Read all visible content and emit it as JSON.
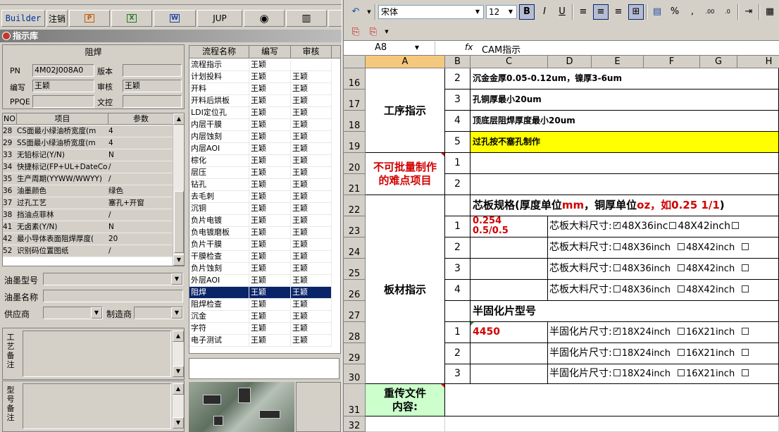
{
  "toolbar": {
    "builder_label": "Builder",
    "logout_label": "注销",
    "jup_label": "JUP"
  },
  "library": {
    "title": "指示库"
  },
  "info": {
    "title": "阻焊",
    "pn_label": "PN",
    "pn_value": "4M02J008A0",
    "version_label": "版本",
    "version_value": "",
    "author_label": "编写",
    "author_value": "王颖",
    "reviewer_label": "审核",
    "reviewer_value": "王颖",
    "ppqe_label": "PPQE",
    "ppqe_value": "",
    "doc_label": "文控",
    "doc_value": ""
  },
  "params": {
    "headers": [
      "NO",
      "项目",
      "参数"
    ],
    "rows": [
      {
        "no": "28",
        "item": "CS面最小绿油桥宽度(m",
        "value": "4"
      },
      {
        "no": "29",
        "item": "SS面最小绿油桥宽度(m",
        "value": "4"
      },
      {
        "no": "33",
        "item": "无铅标记(Y/N)",
        "value": "N"
      },
      {
        "no": "34",
        "item": "快捷标记(FP+UL+DateCo",
        "value": "/"
      },
      {
        "no": "35",
        "item": "生产周期(YYWW/WWYY)",
        "value": "/"
      },
      {
        "no": "36",
        "item": "油墨颜色",
        "value": "绿色"
      },
      {
        "no": "37",
        "item": "过孔工艺",
        "value": "塞孔+开窗"
      },
      {
        "no": "38",
        "item": "挡油点菲林",
        "value": "/"
      },
      {
        "no": "41",
        "item": "无卤素(Y/N)",
        "value": "N"
      },
      {
        "no": "42",
        "item": "最小导体表面阻焊厚度(",
        "value": "20"
      },
      {
        "no": "52",
        "item": "识别码位置图纸",
        "value": "/"
      }
    ]
  },
  "ink": {
    "type_label": "油墨型号",
    "name_label": "油墨名称",
    "supplier_label": "供应商",
    "maker_label": "制造商"
  },
  "remarks": {
    "process_label": "工艺备注",
    "model_label": "型号备注"
  },
  "process_list": {
    "headers": [
      "流程名称",
      "编写",
      "审核"
    ],
    "rows": [
      {
        "name": "流程指示",
        "author": "王颖",
        "reviewer": ""
      },
      {
        "name": "计划投料",
        "author": "王颖",
        "reviewer": "王颖"
      },
      {
        "name": "开料",
        "author": "王颖",
        "reviewer": "王颖"
      },
      {
        "name": "开料后烘板",
        "author": "王颖",
        "reviewer": "王颖"
      },
      {
        "name": "LDI定位孔",
        "author": "王颖",
        "reviewer": "王颖"
      },
      {
        "name": "内层干膜",
        "author": "王颖",
        "reviewer": "王颖"
      },
      {
        "name": "内层蚀刻",
        "author": "王颖",
        "reviewer": "王颖"
      },
      {
        "name": "内层AOI",
        "author": "王颖",
        "reviewer": "王颖"
      },
      {
        "name": "棕化",
        "author": "王颖",
        "reviewer": "王颖"
      },
      {
        "name": "层压",
        "author": "王颖",
        "reviewer": "王颖"
      },
      {
        "name": "钻孔",
        "author": "王颖",
        "reviewer": "王颖"
      },
      {
        "name": "去毛刺",
        "author": "王颖",
        "reviewer": "王颖"
      },
      {
        "name": "沉铜",
        "author": "王颖",
        "reviewer": "王颖"
      },
      {
        "name": "负片电镀",
        "author": "王颖",
        "reviewer": "王颖"
      },
      {
        "name": "负电镀磨板",
        "author": "王颖",
        "reviewer": "王颖"
      },
      {
        "name": "负片干膜",
        "author": "王颖",
        "reviewer": "王颖"
      },
      {
        "name": "干膜检查",
        "author": "王颖",
        "reviewer": "王颖"
      },
      {
        "name": "负片蚀刻",
        "author": "王颖",
        "reviewer": "王颖"
      },
      {
        "name": "外层AOI",
        "author": "王颖",
        "reviewer": "王颖"
      },
      {
        "name": "阻焊",
        "author": "王颖",
        "reviewer": "王颖",
        "selected": true
      },
      {
        "name": "阻焊检查",
        "author": "王颖",
        "reviewer": "王颖"
      },
      {
        "name": "沉金",
        "author": "王颖",
        "reviewer": "王颖"
      },
      {
        "name": "字符",
        "author": "王颖",
        "reviewer": "王颖"
      },
      {
        "name": "电子测试",
        "author": "王颖",
        "reviewer": "王颖"
      }
    ]
  },
  "excel": {
    "font_name": "宋体",
    "font_size": "12",
    "name_box": "A8",
    "formula": "CAM指示",
    "columns": [
      "A",
      "B",
      "C",
      "D",
      "E",
      "F",
      "G",
      "H"
    ],
    "rows": [
      "16",
      "17",
      "18",
      "19",
      "20",
      "21",
      "22",
      "23",
      "24",
      "25",
      "26",
      "27",
      "28",
      "29",
      "30",
      "31",
      "32"
    ],
    "cells": {
      "process_instr": "工序指示",
      "hard_items_l1": "不可批量制作",
      "hard_items_l2": "的难点项目",
      "board_instr": "板材指示",
      "resend_l1": "重传文件",
      "resend_l2": "内容:",
      "n2": "2",
      "n3": "3",
      "n4": "4",
      "n5": "5",
      "h1": "1",
      "h2": "2",
      "b1": "1",
      "b2": "2",
      "b3": "3",
      "b4": "4",
      "p1": "1",
      "p2": "2",
      "p3": "3",
      "instr2": "沉金金厚0.05-0.12um，镍厚3-6um",
      "instr3": "孔铜厚最小20um",
      "instr4": "顶底层阻焊厚度最小20um",
      "instr5": "过孔按不塞孔制作",
      "core_spec_a": "芯板规格(厚度单位",
      "core_spec_mm": "mm",
      "core_spec_b": "，铜厚单位",
      "core_spec_oz": "oz，如0.25 1/1",
      "core_spec_c": ")",
      "core_val1": "0.254",
      "core_val2": "0.5/0.5",
      "core_size_label": "芯板大料尺寸:",
      "size_48x36": "48X36inch",
      "size_48x36_first": "48X36inc",
      "size_48x42": "48X42inch",
      "prepreg_title": "半固化片型号",
      "prepreg_val": "4450",
      "prepreg_size_label": "半固化片尺寸:",
      "size_18x24": "18X24inch",
      "size_16x21": "16X21inch"
    }
  }
}
